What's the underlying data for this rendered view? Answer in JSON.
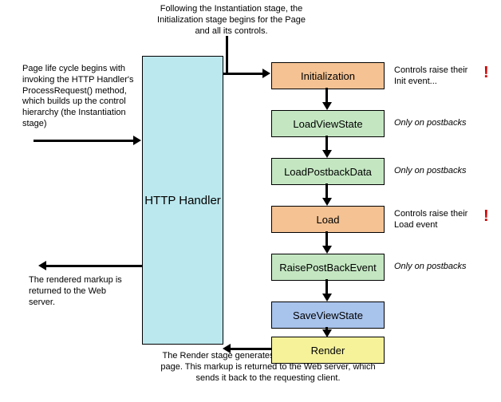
{
  "annotations": {
    "top": "Following the Instantiation stage, the Initialization stage begins for the Page and all its controls.",
    "left_top": "Page life cycle begins with invoking the HTTP Handler's ProcessRequest() method, which builds up the control hierarchy (the Instantiation stage)",
    "left_bottom": "The rendered markup is returned to the Web server.",
    "bottom": "The Render stage generates the HTML markup for the page. This markup is returned to the Web server, which sends it back to the requesting client.",
    "init_note": "Controls raise their Init event...",
    "load_note": "Controls raise their Load event",
    "postback_note": "Only on postbacks"
  },
  "handler": {
    "label": "HTTP Handler"
  },
  "stages": {
    "initialization": "Initialization",
    "load_view_state": "LoadViewState",
    "load_postback_data": "LoadPostbackData",
    "load": "Load",
    "raise_postback_event": "RaisePostBackEvent",
    "save_view_state": "SaveViewState",
    "render": "Render"
  },
  "exclaim": "!"
}
